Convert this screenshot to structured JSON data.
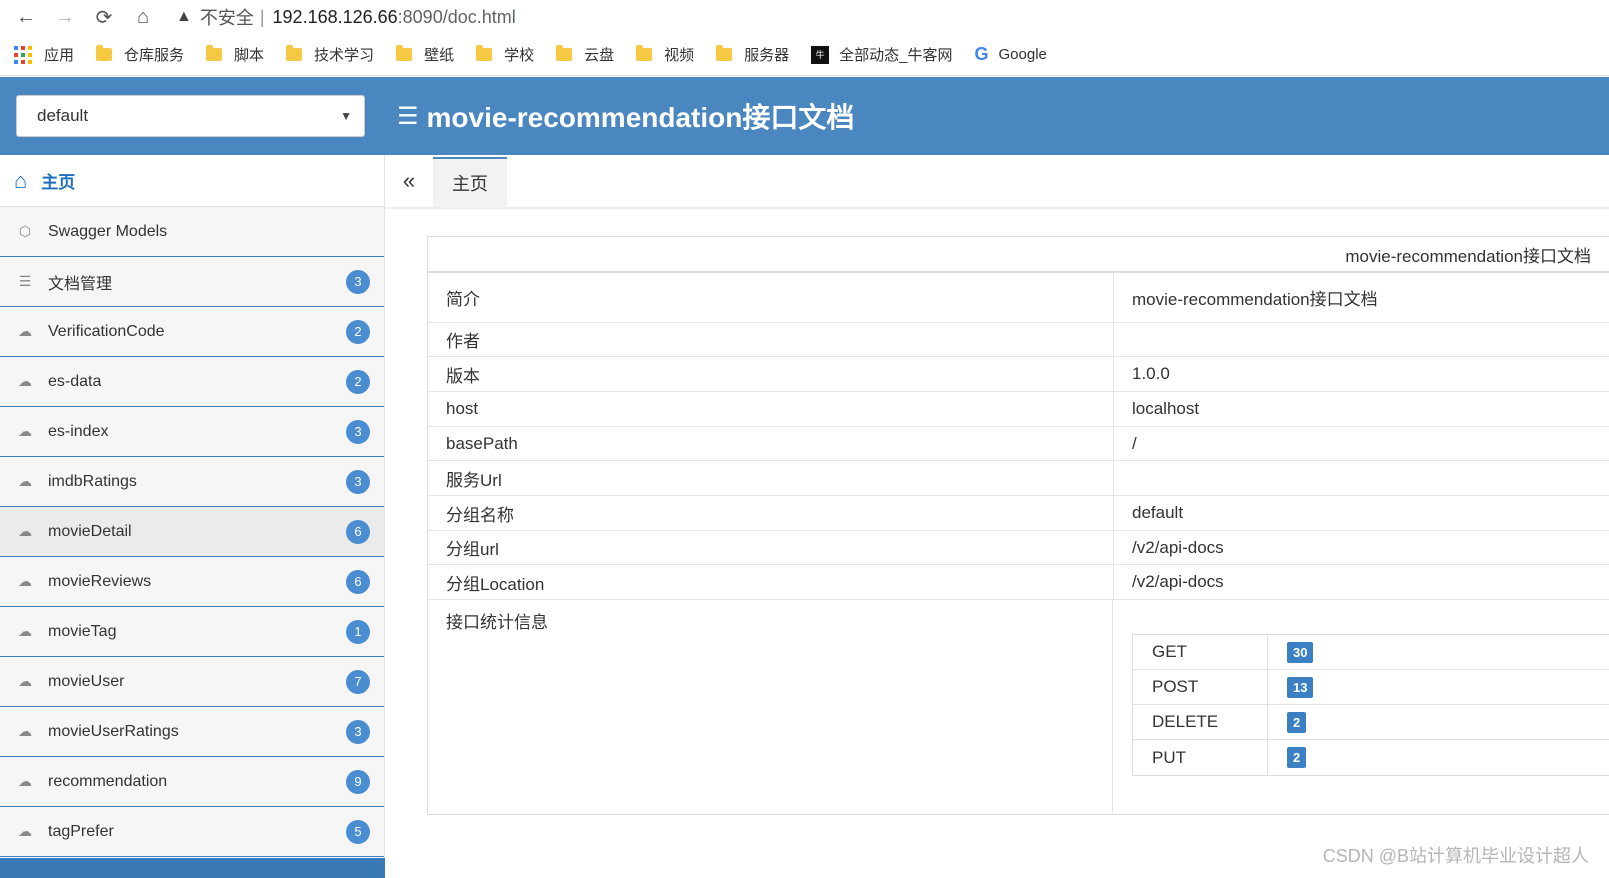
{
  "browser": {
    "back_icon": "←",
    "forward_icon": "→",
    "reload_icon": "⟳",
    "home_icon": "⌂",
    "security_label": "不安全",
    "url_host": "192.168.126.66",
    "url_path": ":8090/doc.html"
  },
  "bookmarks": [
    {
      "label": "应用",
      "type": "apps"
    },
    {
      "label": "仓库服务",
      "type": "folder"
    },
    {
      "label": "脚本",
      "type": "folder"
    },
    {
      "label": "技术学习",
      "type": "folder"
    },
    {
      "label": "壁纸",
      "type": "folder"
    },
    {
      "label": "学校",
      "type": "folder"
    },
    {
      "label": "云盘",
      "type": "folder"
    },
    {
      "label": "视频",
      "type": "folder"
    },
    {
      "label": "服务器",
      "type": "folder"
    },
    {
      "label": "全部动态_牛客网",
      "type": "nowcoder"
    },
    {
      "label": "Google",
      "type": "google"
    }
  ],
  "header": {
    "group_selected": "default",
    "title": "movie-recommendation接口文档",
    "accent_color": "#4a86c0"
  },
  "sidebar": {
    "home_label": "主页",
    "items": [
      {
        "label": "Swagger Models",
        "badge": "",
        "icon": "swagger-models-icon"
      },
      {
        "label": "文档管理",
        "badge": "3",
        "icon": "document-settings-icon"
      },
      {
        "label": "VerificationCode",
        "badge": "2",
        "icon": "api-cloud-icon"
      },
      {
        "label": "es-data",
        "badge": "2",
        "icon": "api-cloud-icon"
      },
      {
        "label": "es-index",
        "badge": "3",
        "icon": "api-cloud-icon"
      },
      {
        "label": "imdbRatings",
        "badge": "3",
        "icon": "api-cloud-icon"
      },
      {
        "label": "movieDetail",
        "badge": "6",
        "icon": "api-cloud-icon"
      },
      {
        "label": "movieReviews",
        "badge": "6",
        "icon": "api-cloud-icon"
      },
      {
        "label": "movieTag",
        "badge": "1",
        "icon": "api-cloud-icon"
      },
      {
        "label": "movieUser",
        "badge": "7",
        "icon": "api-cloud-icon"
      },
      {
        "label": "movieUserRatings",
        "badge": "3",
        "icon": "api-cloud-icon"
      },
      {
        "label": "recommendation",
        "badge": "9",
        "icon": "api-cloud-icon"
      },
      {
        "label": "tagPrefer",
        "badge": "5",
        "icon": "api-cloud-icon"
      }
    ]
  },
  "tabs": {
    "collapse_icon": "«",
    "active_tab": "主页"
  },
  "doc": {
    "heading": "movie-recommendation接口文档",
    "rows": [
      {
        "key": "简介",
        "value": "movie-recommendation接口文档"
      },
      {
        "key": "作者",
        "value": ""
      },
      {
        "key": "版本",
        "value": "1.0.0"
      },
      {
        "key": "host",
        "value": "localhost"
      },
      {
        "key": "basePath",
        "value": "/"
      },
      {
        "key": "服务Url",
        "value": ""
      },
      {
        "key": "分组名称",
        "value": "default"
      },
      {
        "key": "分组url",
        "value": "/v2/api-docs"
      },
      {
        "key": "分组Location",
        "value": "/v2/api-docs"
      }
    ],
    "stats_label": "接口统计信息",
    "stats": [
      {
        "method": "GET",
        "count": "30"
      },
      {
        "method": "POST",
        "count": "13"
      },
      {
        "method": "DELETE",
        "count": "2"
      },
      {
        "method": "PUT",
        "count": "2"
      }
    ]
  },
  "watermark": "CSDN @B站计算机毕业设计超人"
}
